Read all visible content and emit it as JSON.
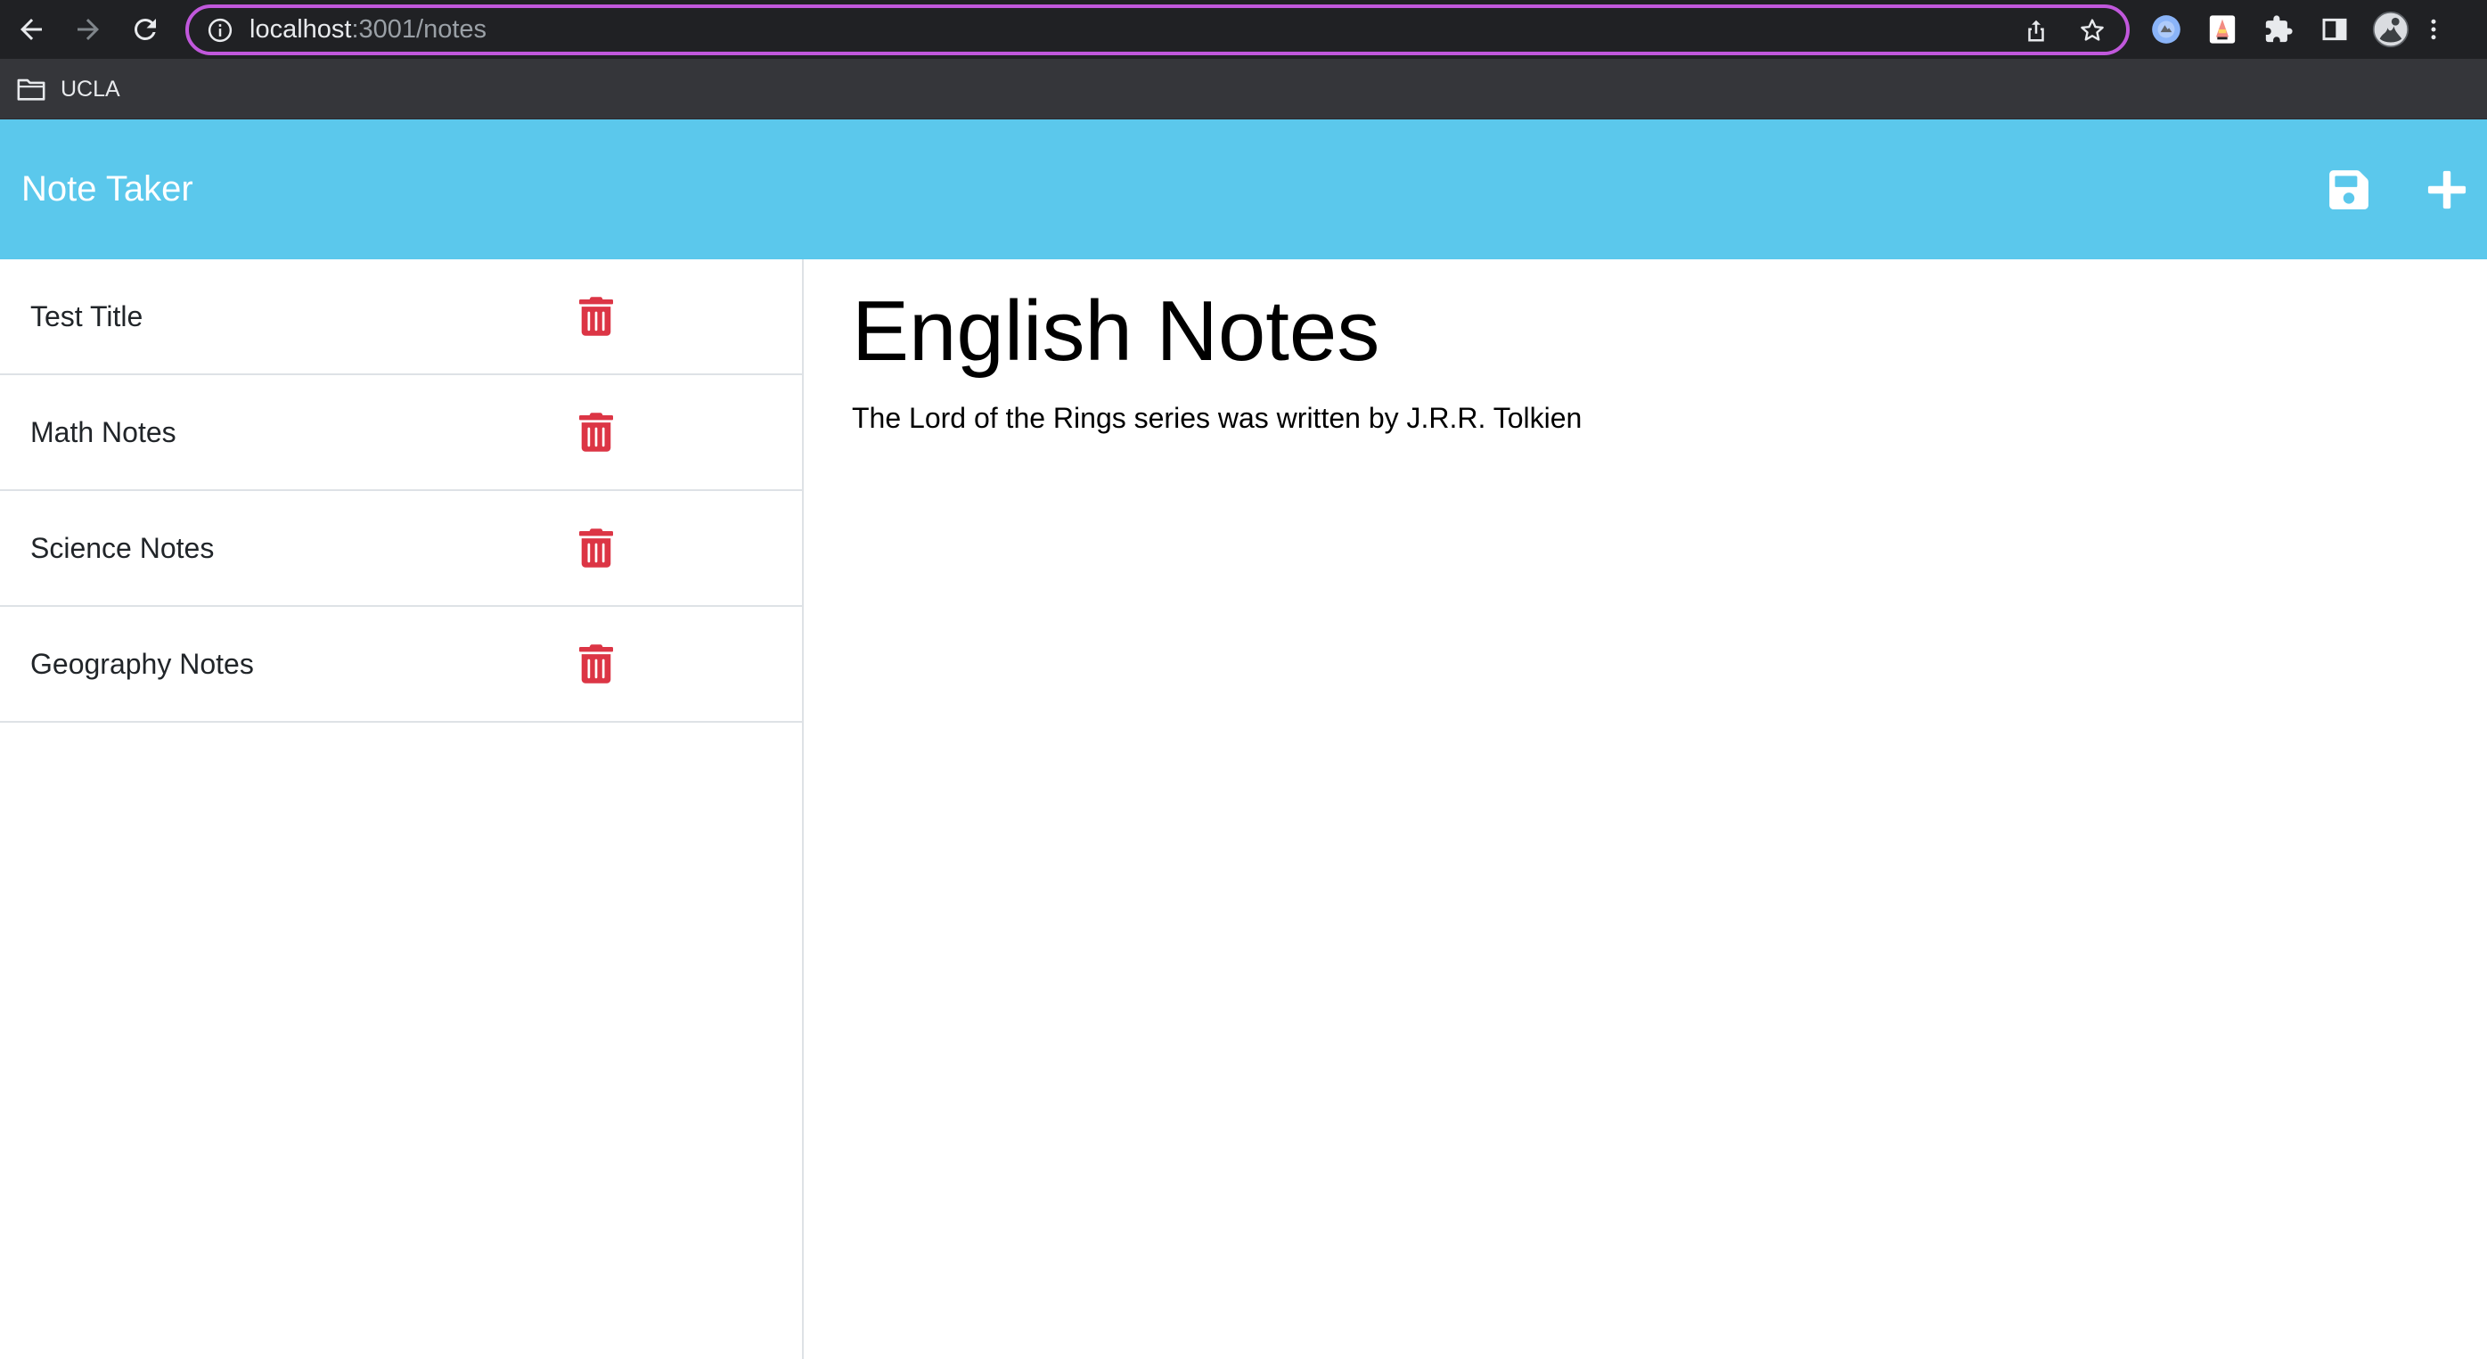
{
  "browser": {
    "url_host": "localhost",
    "url_path": ":3001/notes",
    "bookmarks": [
      {
        "label": "UCLA"
      }
    ],
    "extensions": [
      "extension-1-icon",
      "extension-2-icon",
      "puzzle-icon",
      "side-panel-icon",
      "profile-avatar",
      "kebab-menu-icon"
    ]
  },
  "app": {
    "brand": "Note Taker",
    "accent_color": "#5bc8ec",
    "delete_color": "#dc3545",
    "actions": [
      "save-icon",
      "plus-icon"
    ]
  },
  "notes": [
    {
      "title": "Test Title"
    },
    {
      "title": "Math Notes"
    },
    {
      "title": "Science Notes"
    },
    {
      "title": "Geography Notes"
    }
  ],
  "active_note": {
    "title": "English Notes",
    "text": "The Lord of the Rings series was written by J.R.R. Tolkien"
  }
}
